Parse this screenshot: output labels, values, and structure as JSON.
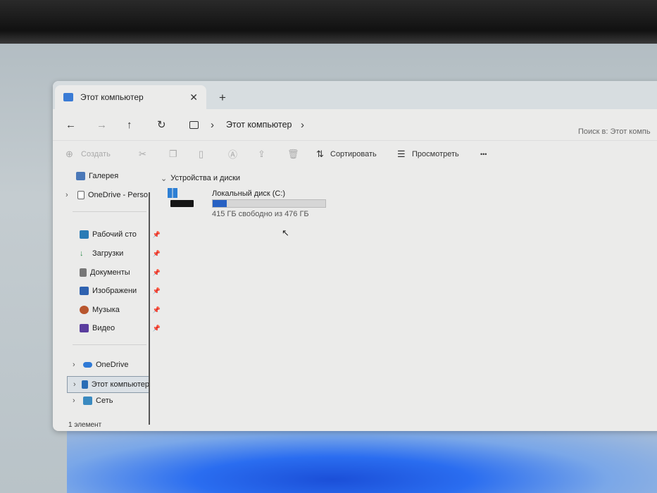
{
  "window": {
    "tab_title": "Этот компьютер",
    "close": "✕",
    "new_tab": "+"
  },
  "nav": {
    "back": "←",
    "forward": "→",
    "up": "↑",
    "refresh": "↻",
    "breadcrumb": "Этот компьютер",
    "sep": "›",
    "search_placeholder": "Поиск в: Этот компь"
  },
  "toolbar": {
    "create": "Создать",
    "sort": "Сортировать",
    "view": "Просмотреть",
    "more": "•••"
  },
  "sidebar": {
    "top": [
      {
        "label": "Галерея"
      },
      {
        "label": "OneDrive - Perso"
      }
    ],
    "pinned": [
      {
        "label": "Рабочий сто"
      },
      {
        "label": "Загрузки"
      },
      {
        "label": "Документы"
      },
      {
        "label": "Изображени"
      },
      {
        "label": "Музыка"
      },
      {
        "label": "Видео"
      }
    ],
    "bottom": [
      {
        "label": "OneDrive"
      },
      {
        "label": "Этот компьютер"
      },
      {
        "label": "Сеть"
      }
    ]
  },
  "main": {
    "group": "Устройства и диски",
    "drive": {
      "name": "Локальный диск (C:)",
      "free_text": "415 ГБ свободно из 476 ГБ",
      "used_fraction": 0.128,
      "bar_color": "#2761c3"
    }
  },
  "status": {
    "count": "1 элемент"
  }
}
